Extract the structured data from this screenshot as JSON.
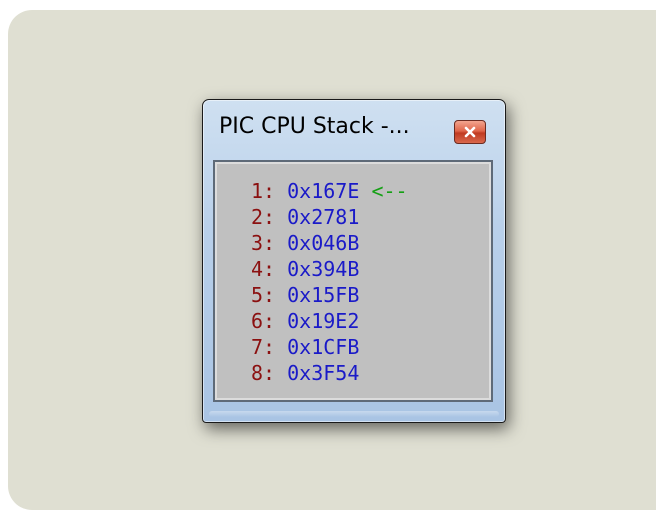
{
  "window": {
    "title": "PIC CPU Stack -...",
    "close_icon": "close-icon"
  },
  "stack": {
    "pointer_marker": "<--",
    "entries": [
      {
        "index": "1:",
        "address": "0x167E",
        "current": true
      },
      {
        "index": "2:",
        "address": "0x2781",
        "current": false
      },
      {
        "index": "3:",
        "address": "0x046B",
        "current": false
      },
      {
        "index": "4:",
        "address": "0x394B",
        "current": false
      },
      {
        "index": "5:",
        "address": "0x15FB",
        "current": false
      },
      {
        "index": "6:",
        "address": "0x19E2",
        "current": false
      },
      {
        "index": "7:",
        "address": "0x1CFB",
        "current": false
      },
      {
        "index": "8:",
        "address": "0x3F54",
        "current": false
      }
    ]
  },
  "colors": {
    "index": "#8b1010",
    "address": "#1a1ac8",
    "pointer": "#14a014",
    "client_background": "#c0c0c0",
    "desktop": "#dfdfd2"
  }
}
